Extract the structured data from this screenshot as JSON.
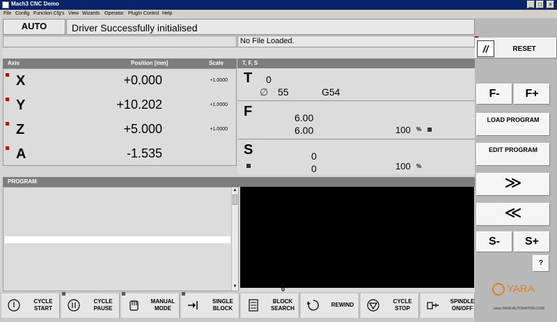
{
  "window": {
    "title": "Mach3 CNC Demo",
    "controls": [
      "_",
      "□",
      "×"
    ]
  },
  "menu": [
    "File",
    "Config",
    "Function Cfg's",
    "View",
    "Wizards",
    "Operator",
    "PlugIn Control",
    "Help"
  ],
  "mode": {
    "label": "AUTO"
  },
  "status": {
    "message": "Driver Successfully initialised"
  },
  "file": {
    "name": "No File Loaded."
  },
  "axes_panel": {
    "header": {
      "axis": "Axis",
      "position": "Position [mm]",
      "scale": "Scale"
    },
    "rows": [
      {
        "name": "X",
        "position": "+0.000",
        "scale": "+1.0000"
      },
      {
        "name": "Y",
        "position": "+10.202",
        "scale": "+1.0000"
      },
      {
        "name": "Z",
        "position": "+5.000",
        "scale": "+1.0000"
      },
      {
        "name": "A",
        "position": "-1.535",
        "scale": ""
      }
    ]
  },
  "tfs_panel": {
    "header": "T, F, S",
    "tool": {
      "label": "T",
      "number": "0",
      "diameter_symbol": "∅",
      "diameter": "55",
      "offset": "G54"
    },
    "feed": {
      "label": "F",
      "set": "6.00",
      "actual": "6.00",
      "override": "100",
      "unit": "%"
    },
    "spindle": {
      "label": "S",
      "set": "0",
      "actual": "0",
      "override": "100",
      "unit": "%"
    }
  },
  "program_panel": {
    "header": "PROGRAM",
    "counter": "0"
  },
  "side_buttons": {
    "reset": "RESET",
    "feed_minus": "F-",
    "feed_plus": "F+",
    "load_program": "LOAD PROGRAM",
    "edit_program": "EDIT PROGRAM",
    "forward": "≫",
    "back": "≪",
    "spindle_minus": "S-",
    "spindle_plus": "S+",
    "help": "?"
  },
  "logo": {
    "brand": "YARA",
    "url": "www.YARA-AUTOMATION.COM"
  },
  "bottom_buttons": [
    {
      "label": "CYCLE START",
      "icon": "power-icon"
    },
    {
      "label": "CYCLE PAUSE",
      "icon": "pause-icon"
    },
    {
      "label": "MANUAL MODE",
      "icon": "hand-icon"
    },
    {
      "label": "SINGLE BLOCK",
      "icon": "single-block-icon"
    },
    {
      "label": "BLOCK SEARCH",
      "icon": "block-search-icon"
    },
    {
      "label": "REWIND",
      "icon": "rewind-icon"
    },
    {
      "label": "CYCLE STOP",
      "icon": "stop-icon"
    },
    {
      "label": "SPINDLE ON/OFF",
      "icon": "spindle-icon"
    }
  ],
  "colors": {
    "led_red": "#c00000",
    "header_gray": "#7d7d7d",
    "screen_black": "#000000",
    "title_blue": "#0a246a"
  }
}
